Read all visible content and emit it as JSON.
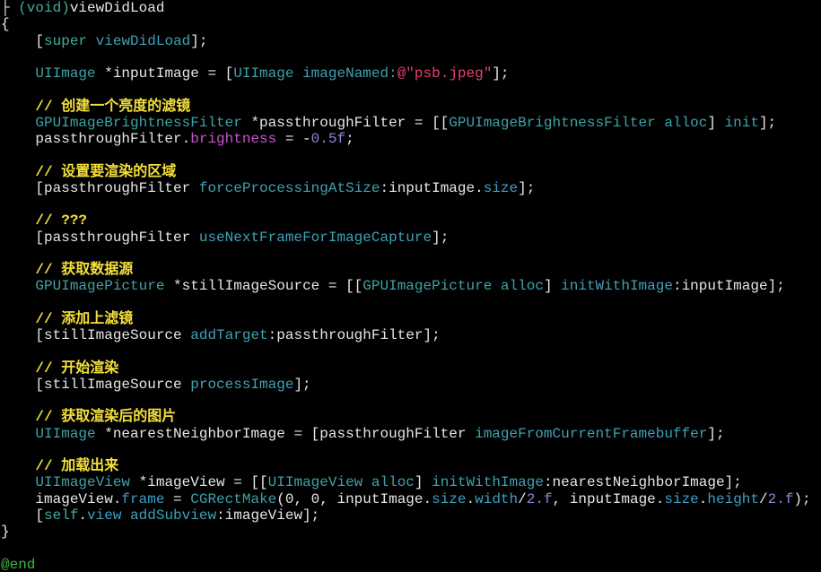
{
  "editor": {
    "theme": {
      "background": "#000000",
      "plain": "#e6e6e6",
      "keyword": "#3fae9c",
      "class": "#3ea2a8",
      "method": "#3ea2b4",
      "string": "#e8426e",
      "number": "#9184d8",
      "property_brightness": "#c653c8",
      "property": "#3a9fc8",
      "comment": "#f3e03a",
      "directive": "#41b247"
    },
    "lines": [
      [
        [
          "├ ",
          "p"
        ],
        [
          "(void)",
          "k"
        ],
        [
          "viewDidLoad",
          "p"
        ]
      ],
      [
        [
          "{",
          "p"
        ]
      ],
      [
        [
          "    [",
          "p"
        ],
        [
          "super",
          "k"
        ],
        [
          " ",
          "p"
        ],
        [
          "viewDidLoad",
          "m"
        ],
        [
          "];",
          "p"
        ]
      ],
      [],
      [
        [
          "    ",
          "p"
        ],
        [
          "UIImage",
          "c"
        ],
        [
          " *inputImage = [",
          "p"
        ],
        [
          "UIImage",
          "c"
        ],
        [
          " ",
          "p"
        ],
        [
          "imageNamed:",
          "m"
        ],
        [
          "@\"psb.jpeg\"",
          "s"
        ],
        [
          "];",
          "p"
        ]
      ],
      [],
      [
        [
          "    // 创建一个亮度的滤镜",
          "cm"
        ]
      ],
      [
        [
          "    ",
          "p"
        ],
        [
          "GPUImageBrightnessFilter",
          "c"
        ],
        [
          " *passthroughFilter = [[",
          "p"
        ],
        [
          "GPUImageBrightnessFilter",
          "c"
        ],
        [
          " ",
          "p"
        ],
        [
          "alloc",
          "m"
        ],
        [
          "] ",
          "p"
        ],
        [
          "init",
          "m"
        ],
        [
          "];",
          "p"
        ]
      ],
      [
        [
          "    passthroughFilter.",
          "p"
        ],
        [
          "brightness",
          "pr"
        ],
        [
          " = -",
          "p"
        ],
        [
          "0.5f",
          "n"
        ],
        [
          ";",
          "p"
        ]
      ],
      [],
      [
        [
          "    // 设置要渲染的区域",
          "cm"
        ]
      ],
      [
        [
          "    [passthroughFilter ",
          "p"
        ],
        [
          "forceProcessingAtSize",
          "m"
        ],
        [
          ":inputImage.",
          "p"
        ],
        [
          "size",
          "pt"
        ],
        [
          "];",
          "p"
        ]
      ],
      [],
      [
        [
          "    // ???",
          "cm"
        ]
      ],
      [
        [
          "    [passthroughFilter ",
          "p"
        ],
        [
          "useNextFrameForImageCapture",
          "m"
        ],
        [
          "];",
          "p"
        ]
      ],
      [],
      [
        [
          "    // 获取数据源",
          "cm"
        ]
      ],
      [
        [
          "    ",
          "p"
        ],
        [
          "GPUImagePicture",
          "c"
        ],
        [
          " *stillImageSource = [[",
          "p"
        ],
        [
          "GPUImagePicture",
          "c"
        ],
        [
          " ",
          "p"
        ],
        [
          "alloc",
          "m"
        ],
        [
          "] ",
          "p"
        ],
        [
          "initWithImage",
          "m"
        ],
        [
          ":inputImage];",
          "p"
        ]
      ],
      [],
      [
        [
          "    // 添加上滤镜",
          "cm"
        ]
      ],
      [
        [
          "    [stillImageSource ",
          "p"
        ],
        [
          "addTarget",
          "m"
        ],
        [
          ":passthroughFilter];",
          "p"
        ]
      ],
      [],
      [
        [
          "    // 开始渲染",
          "cm"
        ]
      ],
      [
        [
          "    [stillImageSource ",
          "p"
        ],
        [
          "processImage",
          "m"
        ],
        [
          "];",
          "p"
        ]
      ],
      [],
      [
        [
          "    // 获取渲染后的图片",
          "cm"
        ]
      ],
      [
        [
          "    ",
          "p"
        ],
        [
          "UIImage",
          "c"
        ],
        [
          " *nearestNeighborImage = [passthroughFilter ",
          "p"
        ],
        [
          "imageFromCurrentFramebuffer",
          "m"
        ],
        [
          "];",
          "p"
        ]
      ],
      [],
      [
        [
          "    // 加载出来",
          "cm"
        ]
      ],
      [
        [
          "    ",
          "p"
        ],
        [
          "UIImageView",
          "c"
        ],
        [
          " *imageView = [[",
          "p"
        ],
        [
          "UIImageView",
          "c"
        ],
        [
          " ",
          "p"
        ],
        [
          "alloc",
          "m"
        ],
        [
          "] ",
          "p"
        ],
        [
          "initWithImage",
          "m"
        ],
        [
          ":nearestNeighborImage];",
          "p"
        ]
      ],
      [
        [
          "    imageView.",
          "p"
        ],
        [
          "frame",
          "pt"
        ],
        [
          " = ",
          "p"
        ],
        [
          "CGRectMake",
          "c"
        ],
        [
          "(0, 0, inputImage.",
          "p"
        ],
        [
          "size",
          "pt"
        ],
        [
          ".",
          "p"
        ],
        [
          "width",
          "pt"
        ],
        [
          "/",
          "p"
        ],
        [
          "2.f",
          "n"
        ],
        [
          ", inputImage.",
          "p"
        ],
        [
          "size",
          "pt"
        ],
        [
          ".",
          "p"
        ],
        [
          "height",
          "pt"
        ],
        [
          "/",
          "p"
        ],
        [
          "2.f",
          "n"
        ],
        [
          ");",
          "p"
        ]
      ],
      [
        [
          "    [",
          "p"
        ],
        [
          "self",
          "k"
        ],
        [
          ".",
          "p"
        ],
        [
          "view",
          "pt"
        ],
        [
          " ",
          "p"
        ],
        [
          "addSubview",
          "m"
        ],
        [
          ":imageView];",
          "p"
        ]
      ],
      [
        [
          "}",
          "p"
        ]
      ],
      [],
      [
        [
          "@end",
          "d"
        ]
      ]
    ]
  }
}
